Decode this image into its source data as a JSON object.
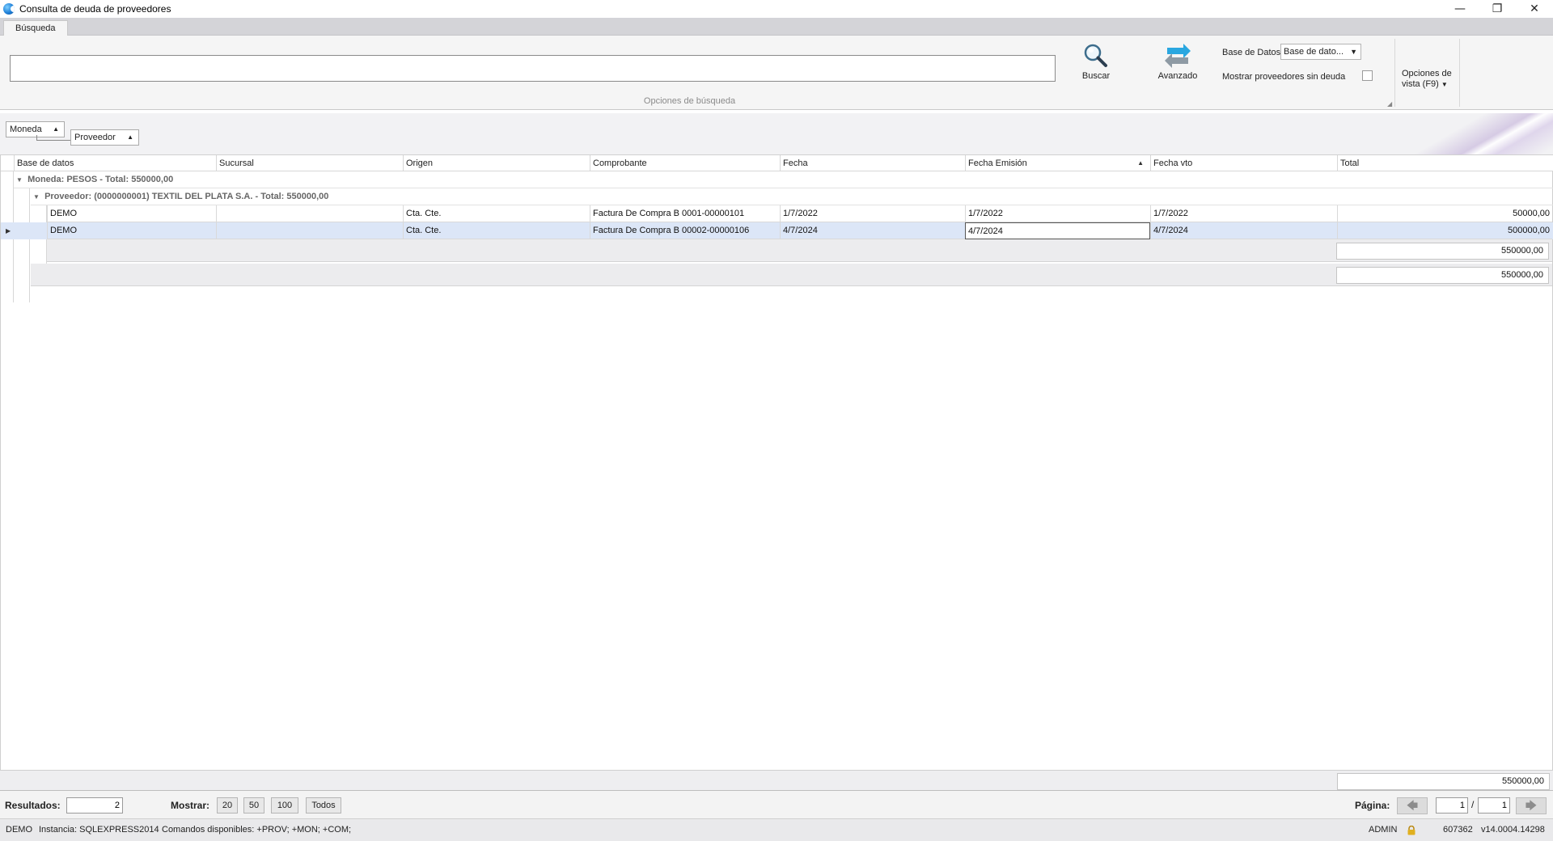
{
  "window": {
    "title": "Consulta de deuda de proveedores",
    "controls": {
      "minimize": "—",
      "restore": "❐",
      "close": "✕"
    }
  },
  "ribbon": {
    "tab": "Búsqueda",
    "search_value": "",
    "group_caption": "Opciones de búsqueda",
    "buscar_label": "Buscar",
    "avanzado_label": "Avanzado",
    "db_label": "Base de Datos",
    "db_value": "Base de dato...",
    "sin_deuda_label": "Mostrar proveedores sin deuda",
    "sin_deuda_checked": false,
    "view_options_line1": "Opciones de",
    "view_options_line2": "vista (F9)"
  },
  "grouping": {
    "chips": [
      "Moneda",
      "Proveedor"
    ]
  },
  "grid": {
    "columns": [
      "Base de datos",
      "Sucursal",
      "Origen",
      "Comprobante",
      "Fecha",
      "Fecha Emisión",
      "Fecha vto",
      "Total"
    ],
    "sorted_column": "Fecha Emisión",
    "group1": "Moneda: PESOS  - Total: 550000,00",
    "group2": "Proveedor: (0000000001) TEXTIL DEL PLATA S.A.  - Total: 550000,00",
    "rows": [
      {
        "base": "DEMO",
        "sucursal": "",
        "origen": "Cta. Cte.",
        "comprobante": "Factura De Compra B 0001-00000101",
        "fecha": "1/7/2022",
        "emision": "1/7/2022",
        "vto": "1/7/2022",
        "total": "50000,00"
      },
      {
        "base": "DEMO",
        "sucursal": "",
        "origen": "Cta. Cte.",
        "comprobante": "Factura De Compra B 00002-00000106",
        "fecha": "4/7/2024",
        "emision": "4/7/2024",
        "vto": "4/7/2024",
        "total": "500000,00"
      }
    ],
    "group2_sum": "550000,00",
    "group1_sum": "550000,00",
    "grand_total": "550000,00"
  },
  "pager": {
    "results_label": "Resultados:",
    "results_value": "2",
    "show_label": "Mostrar:",
    "sizes": [
      "20",
      "50",
      "100",
      "Todos"
    ],
    "page_label": "Página:",
    "page_current": "1",
    "page_sep": "/",
    "page_total": "1"
  },
  "status": {
    "db": "DEMO",
    "instance": "Instancia: SQLEXPRESS2014",
    "commands": "Comandos disponibles: +PROV; +MON; +COM;",
    "user": "ADMIN",
    "number": "607362",
    "version": "v14.0004.14298"
  }
}
